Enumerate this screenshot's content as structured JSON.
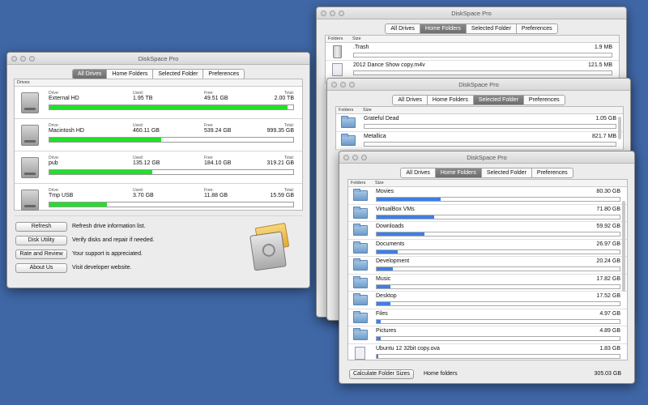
{
  "app_title": "DiskSpace Pro",
  "colors": {
    "desktop": "#3f67a6",
    "drive_fill": "#22e02a",
    "folder_fill": "#3e7ee6"
  },
  "tabs": [
    "All Drives",
    "Home Folders",
    "Selected Folder",
    "Preferences"
  ],
  "win1": {
    "active_tab": "All Drives",
    "panel_header": "Drives",
    "labels": {
      "drive": "Drive:",
      "used": "Used:",
      "free": "Free:",
      "total": "Total:"
    },
    "drives": [
      {
        "name": "External HD",
        "used": "1.95 TB",
        "free": "49.51 GB",
        "total": "2.00 TB",
        "used_fraction": 0.976
      },
      {
        "name": "Macintosh HD",
        "used": "460.11 GB",
        "free": "539.24 GB",
        "total": "999.35 GB",
        "used_fraction": 0.46
      },
      {
        "name": "pub",
        "used": "135.12 GB",
        "free": "184.10 GB",
        "total": "319.21 GB",
        "used_fraction": 0.423
      },
      {
        "name": "Tmp USB",
        "used": "3.70 GB",
        "free": "11.88 GB",
        "total": "15.59 GB",
        "used_fraction": 0.237
      }
    ],
    "buttons": [
      {
        "label": "Refresh",
        "desc": "Refresh drive information list."
      },
      {
        "label": "Disk Utility",
        "desc": "Verify disks and repair if needed."
      },
      {
        "label": "Rate and Review",
        "desc": "Your support is appreciated."
      },
      {
        "label": "About Us",
        "desc": "Visit developer website."
      }
    ]
  },
  "win2": {
    "active_tab": "Home Folders",
    "col_folders": "Folders",
    "col_size": "Size",
    "items": [
      {
        "name": ".Trash",
        "size": "1.9 MB",
        "icon": "trash-icon",
        "fraction": 0.0
      },
      {
        "name": "2012 Dance Show copy.m4v",
        "size": "121.5 MB",
        "icon": "document-icon",
        "fraction": 0.0
      }
    ]
  },
  "win3": {
    "active_tab": "Selected Folder",
    "col_folders": "Folders",
    "col_size": "Size",
    "items": [
      {
        "name": "Grateful Dead",
        "size": "1.05 GB",
        "icon": "folder-icon",
        "fraction": 0.0
      },
      {
        "name": "Metallica",
        "size": "821.7 MB",
        "icon": "folder-icon",
        "fraction": 0.0
      }
    ]
  },
  "win4": {
    "active_tab": "Home Folders",
    "col_folders": "Folders",
    "col_size": "Size",
    "items": [
      {
        "name": "Movies",
        "size": "80.30 GB",
        "icon": "folder-icon",
        "fraction": 0.263
      },
      {
        "name": "VirtualBox VMs",
        "size": "71.80 GB",
        "icon": "folder-icon",
        "fraction": 0.235
      },
      {
        "name": "Downloads",
        "size": "59.92 GB",
        "icon": "folder-icon",
        "fraction": 0.196
      },
      {
        "name": "Documents",
        "size": "26.97 GB",
        "icon": "folder-icon",
        "fraction": 0.088
      },
      {
        "name": "Development",
        "size": "20.24 GB",
        "icon": "folder-icon",
        "fraction": 0.066
      },
      {
        "name": "Music",
        "size": "17.82 GB",
        "icon": "folder-icon",
        "fraction": 0.058
      },
      {
        "name": "Desktop",
        "size": "17.52 GB",
        "icon": "folder-icon",
        "fraction": 0.057
      },
      {
        "name": "Files",
        "size": "4.97 GB",
        "icon": "folder-icon",
        "fraction": 0.016
      },
      {
        "name": "Pictures",
        "size": "4.89 GB",
        "icon": "folder-icon",
        "fraction": 0.016
      },
      {
        "name": "Ubuntu 12 32bit copy.ova",
        "size": "1.83 GB",
        "icon": "document-icon",
        "fraction": 0.006
      }
    ],
    "calc_button": "Calculate Folder Sizes",
    "footer_label": "Home folders",
    "footer_total": "305.03 GB"
  }
}
